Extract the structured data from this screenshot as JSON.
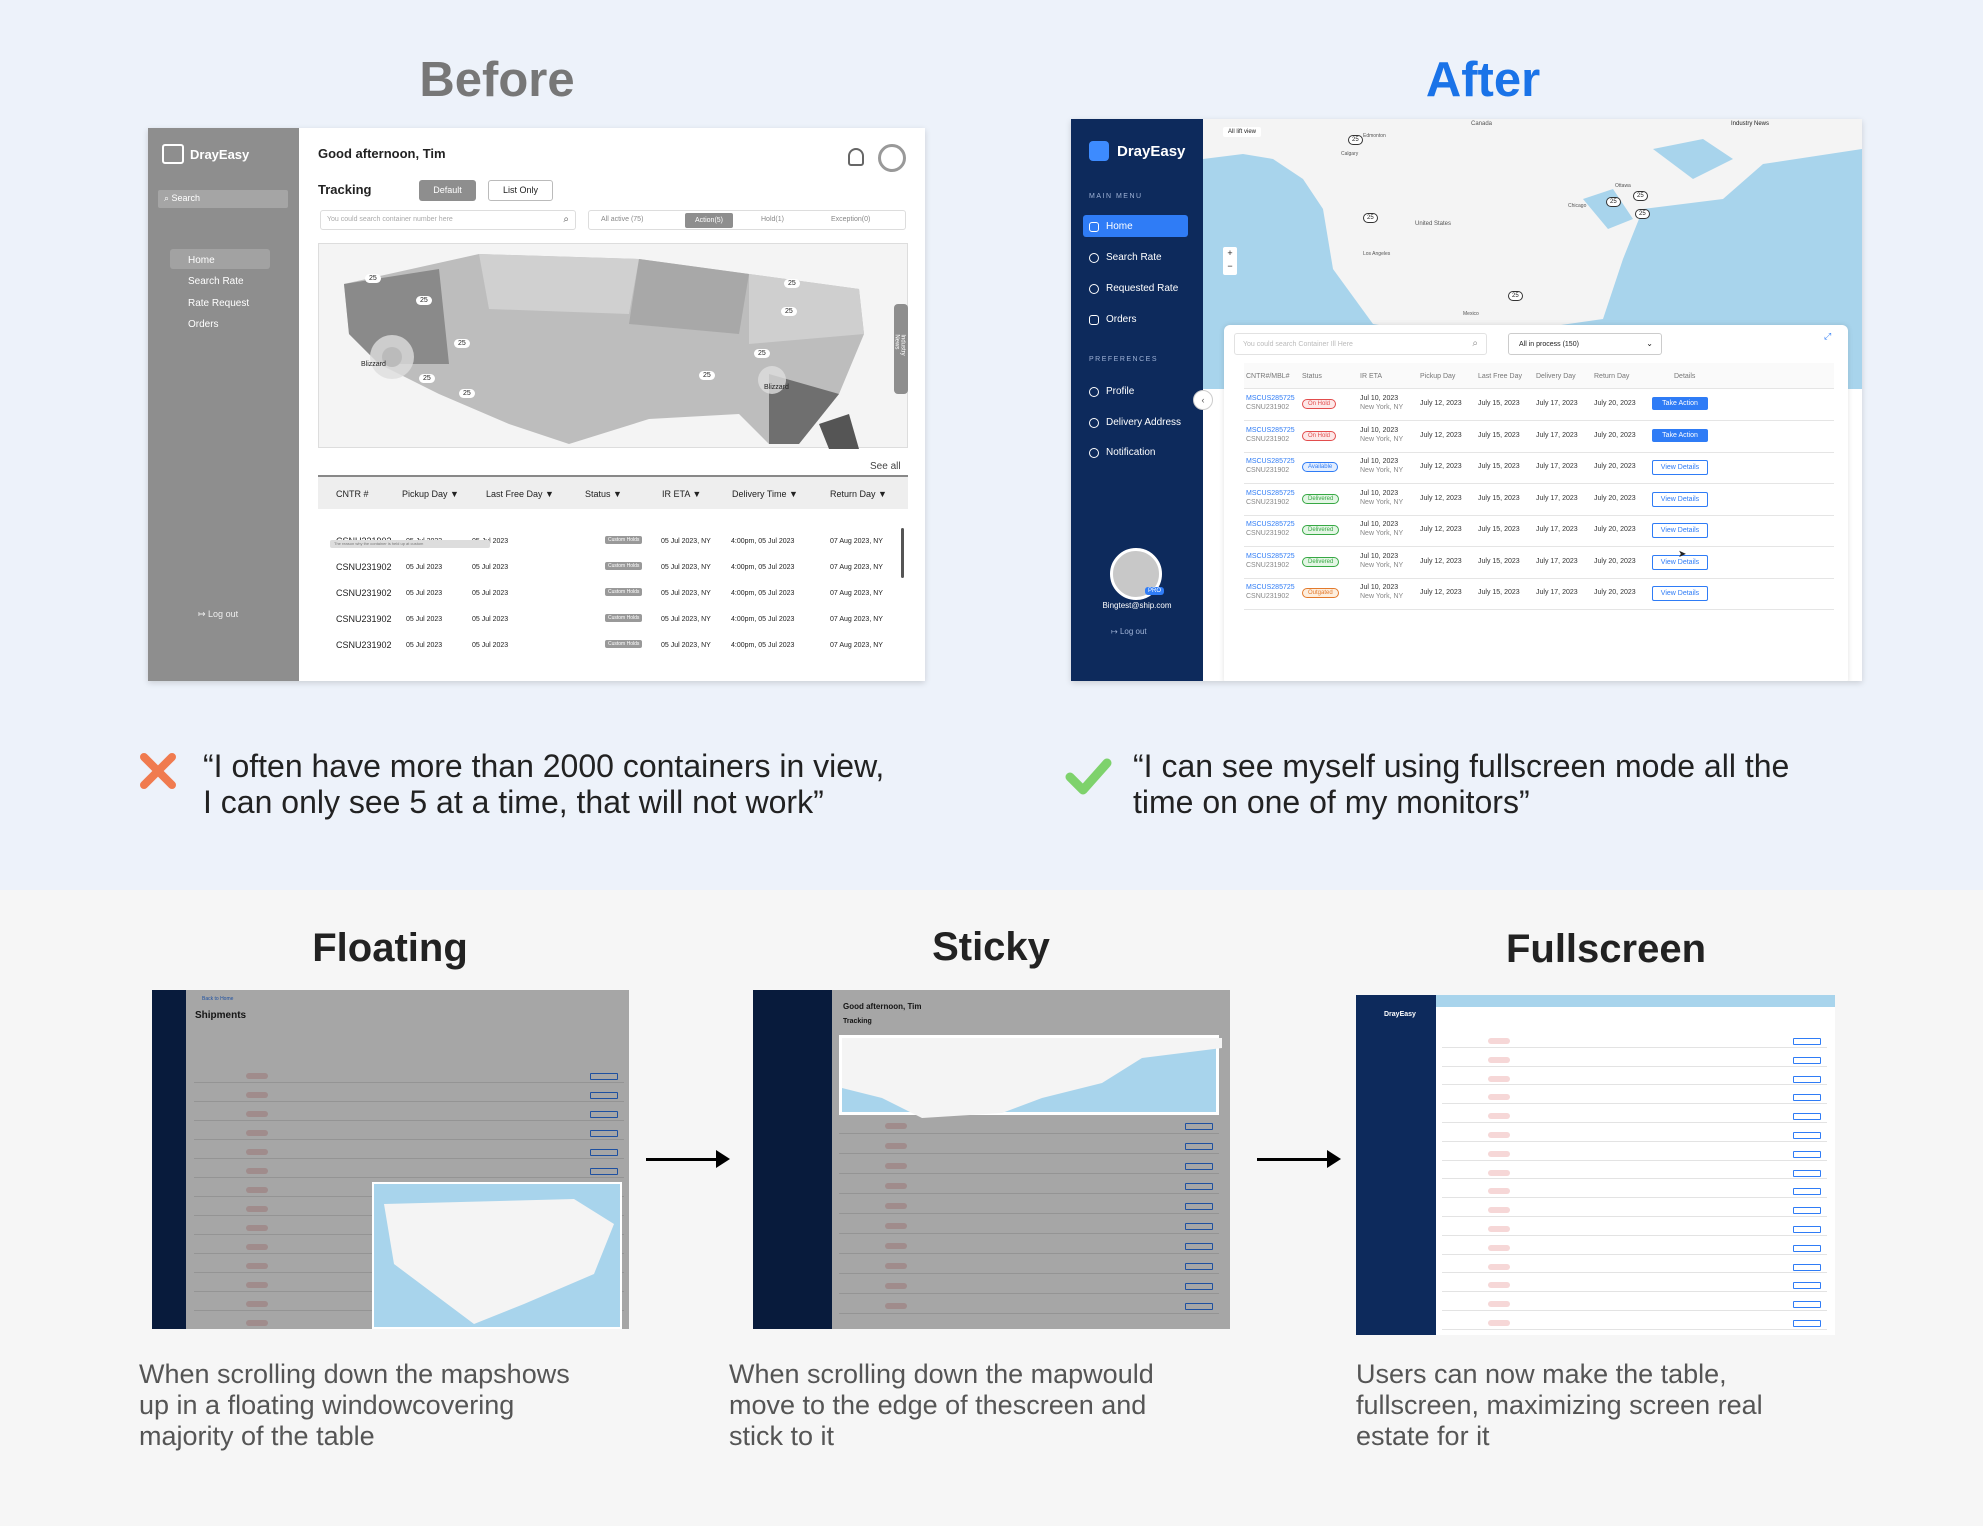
{
  "before": {
    "heading": "Before",
    "app": {
      "brand": "DrayEasy",
      "search": "Search",
      "nav": [
        "Home",
        "Search Rate",
        "Rate Request",
        "Orders"
      ],
      "logout": "Log out",
      "greeting": "Good afternoon, Tim",
      "tracking": "Tracking",
      "toggle": [
        "Default",
        "List Only"
      ],
      "search_placeholder": "You could search container number here",
      "tabs": [
        "All active (75)",
        "Action(5)",
        "Hold(1)",
        "Exception(0)"
      ],
      "map_badges": [
        "25",
        "25",
        "25",
        "25",
        "25",
        "25",
        "25",
        "25",
        "25"
      ],
      "weather": [
        "Blizzard",
        "Blizzard"
      ],
      "industry_news": "Industry News",
      "see_all": "See all",
      "columns": [
        "CNTR #",
        "Pickup Day",
        "Last Free Day",
        "Status",
        "IR ETA",
        "Delivery Time",
        "Return Day"
      ],
      "rows": [
        [
          "CSNU231902",
          "05 Jul 2023",
          "05 Jul 2023",
          "Custom Holds",
          "05 Jul 2023, NY",
          "4:00pm, 05 Jul 2023",
          "07 Aug 2023, NY"
        ],
        [
          "CSNU231902",
          "05 Jul 2023",
          "05 Jul 2023",
          "Custom Holds",
          "05 Jul 2023, NY",
          "4:00pm, 05 Jul 2023",
          "07 Aug 2023, NY"
        ],
        [
          "CSNU231902",
          "05 Jul 2023",
          "05 Jul 2023",
          "Custom Holds",
          "05 Jul 2023, NY",
          "4:00pm, 05 Jul 2023",
          "07 Aug 2023, NY"
        ],
        [
          "CSNU231902",
          "05 Jul 2023",
          "05 Jul 2023",
          "Custom Holds",
          "05 Jul 2023, NY",
          "4:00pm, 05 Jul 2023",
          "07 Aug 2023, NY"
        ],
        [
          "CSNU231902",
          "05 Jul 2023",
          "05 Jul 2023",
          "Custom Holds",
          "05 Jul 2023, NY",
          "4:00pm, 05 Jul 2023",
          "07 Aug 2023, NY"
        ]
      ],
      "row_note": "The reason why the container is held up at custom"
    },
    "quote": "“I often have more than 2000 containers in view,\nI can only see 5 at a time, that will not work”"
  },
  "after": {
    "heading": "After",
    "app": {
      "brand": "DrayEasy",
      "main_menu": "MAIN MENU",
      "nav": [
        "Home",
        "Search Rate",
        "Requested Rate",
        "Orders"
      ],
      "preferences": "PREFERENCES",
      "pref_nav": [
        "Profile",
        "Delivery Address",
        "Notification"
      ],
      "email": "Bingtest@ship.com",
      "pro": "PRO",
      "logout": "Log out",
      "map_labels": [
        "All lift view",
        "Industry News",
        "Canada",
        "Edmonton",
        "Calgary",
        "United States",
        "Chicago",
        "Ottawa",
        "Los Angeles",
        "Mexico"
      ],
      "map_badges": [
        "25",
        "25",
        "25",
        "25",
        "25",
        "25"
      ],
      "search_placeholder": "You could search Container Ill Here",
      "filter": "All in process (150)",
      "columns": [
        "CNTR#/MBL#",
        "Status",
        "IR ETA",
        "Pickup Day",
        "Last Free Day",
        "Delivery Day",
        "Return Day",
        "Details"
      ],
      "rows": [
        {
          "c1": "MSCUS285725",
          "c2": "CSNU231902",
          "status": "On Hold",
          "eta": "Jul 10, 2023",
          "city": "New York, NY",
          "pickup": "July 12, 2023",
          "lfd": "July 15, 2023",
          "delivery": "July 17, 2023",
          "ret": "July 20, 2023",
          "action": "Take Action"
        },
        {
          "c1": "MSCUS285725",
          "c2": "CSNU231902",
          "status": "On Hold",
          "eta": "Jul 10, 2023",
          "city": "New York, NY",
          "pickup": "July 12, 2023",
          "lfd": "July 15, 2023",
          "delivery": "July 17, 2023",
          "ret": "July 20, 2023",
          "action": "Take Action"
        },
        {
          "c1": "MSCUS285725",
          "c2": "CSNU231902",
          "status": "Available",
          "eta": "Jul 10, 2023",
          "city": "New York, NY",
          "pickup": "July 12, 2023",
          "lfd": "July 15, 2023",
          "delivery": "July 17, 2023",
          "ret": "July 20, 2023",
          "action": "View Details"
        },
        {
          "c1": "MSCUS285725",
          "c2": "CSNU231902",
          "status": "Delivered",
          "eta": "Jul 10, 2023",
          "city": "New York, NY",
          "pickup": "July 12, 2023",
          "lfd": "July 15, 2023",
          "delivery": "July 17, 2023",
          "ret": "July 20, 2023",
          "action": "View Details"
        },
        {
          "c1": "MSCUS285725",
          "c2": "CSNU231902",
          "status": "Delivered",
          "eta": "Jul 10, 2023",
          "city": "New York, NY",
          "pickup": "July 12, 2023",
          "lfd": "July 15, 2023",
          "delivery": "July 17, 2023",
          "ret": "July 20, 2023",
          "action": "View Details"
        },
        {
          "c1": "MSCUS285725",
          "c2": "CSNU231902",
          "status": "Delivered",
          "eta": "Jul 10, 2023",
          "city": "New York, NY",
          "pickup": "July 12, 2023",
          "lfd": "July 15, 2023",
          "delivery": "July 17, 2023",
          "ret": "July 20, 2023",
          "action": "View Details"
        },
        {
          "c1": "MSCUS285725",
          "c2": "CSNU231902",
          "status": "Outgated",
          "eta": "Jul 10, 2023",
          "city": "New York, NY",
          "pickup": "July 12, 2023",
          "lfd": "July 15, 2023",
          "delivery": "July 17, 2023",
          "ret": "July 20, 2023",
          "action": "View Details"
        }
      ]
    },
    "quote": "“I can see myself using fullscreen mode all the\ntime on one of my monitors”"
  },
  "floating": {
    "heading": "Floating",
    "back": "Back to Home",
    "title": "Shipments",
    "caption": "When scrolling down the mapshows\nup in a floating windowcovering\nmajority of the table"
  },
  "sticky": {
    "heading": "Sticky",
    "greeting": "Good afternoon, Tim",
    "tracking": "Tracking",
    "caption": "When scrolling down the mapwould\nmove to the edge of thescreen and\nstick to it"
  },
  "fullscreen": {
    "heading": "Fullscreen",
    "brand": "DrayEasy",
    "caption": "Users can now make the table,\nfullscreen, maximizing screen real\nestate for it"
  },
  "colors": {
    "accent": "#1a73e8",
    "navy": "#0d2a5c",
    "bad": "#f07b4f",
    "good": "#7ed26c"
  }
}
